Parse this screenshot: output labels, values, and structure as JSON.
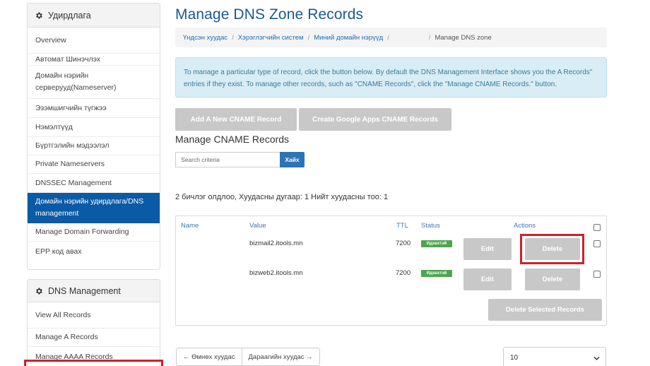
{
  "sidebar": {
    "panel1_title": "Удирдлага",
    "panel1_items": [
      "Overview",
      "Автомат Шинэчлэх",
      "Домайн нэрийн сервeрууд(Nameserver)",
      "Эзэмшигчийн түгжээ",
      "Нэмэлтүүд",
      "Бүртгэлийн мэдээлэл",
      "Private Nameservers",
      "DNSSEC Management",
      "Домайн нэрийн удирдлага/DNS management",
      "Manage Domain Forwarding",
      "EPP код авах"
    ],
    "panel2_title": "DNS Management",
    "panel2_items": [
      "View All Records",
      "Manage A Records",
      "Manage AAAA Records"
    ]
  },
  "page_title": "Manage DNS Zone Records",
  "breadcrumb": {
    "items": [
      "Үндсэн хуудас",
      "Хэрэглэгчийн систем",
      "Миний домайн нэрүүд"
    ],
    "current": "Manage DNS zone"
  },
  "info_text": "To manage a particular type of record, click the button below. By default the DNS Management Interface shows you the  A Records\" entries if they exist. To manage other records, such as \"CNAME Records\", click the \"Manage CNAME Records.\" button.",
  "buttons": {
    "add_cname": "Add A New CNAME Record",
    "google_cname": "Create Google Apps CNAME Records"
  },
  "section_title": "Manage CNAME Records",
  "search": {
    "placeholder": "Search criteria",
    "button": "Хайх"
  },
  "count_text": "2 бичлэг олдлоо, Хуудасны дугаар: 1 Нийт хуудасны тоо: 1",
  "table": {
    "headers": {
      "name": "Name",
      "value": "Value",
      "ttl": "TTL",
      "status": "Status",
      "actions": "Actions"
    },
    "rows": [
      {
        "value": "bizmail2.itools.mn",
        "ttl": "7200",
        "status": "Идэвхтэй",
        "edit": "Edit",
        "delete": "Delete"
      },
      {
        "value": "bizweb2.itools.mn",
        "ttl": "7200",
        "status": "Идэвхтэй",
        "edit": "Edit",
        "delete": "Delete"
      }
    ],
    "delete_selected": "Delete Selected Records"
  },
  "pager": {
    "prev": "← Өмнөх хуудас",
    "next": "Дараагийн хуудас →"
  },
  "page_size": "10",
  "colors": {
    "primary": "#0b5aa6",
    "title": "#1a5a8d",
    "link": "#1a6fb5",
    "info_bg": "#d9edf6",
    "button_disabled": "#c8c8c8",
    "status_green": "#4da64d",
    "highlight_red": "#d0212b"
  }
}
